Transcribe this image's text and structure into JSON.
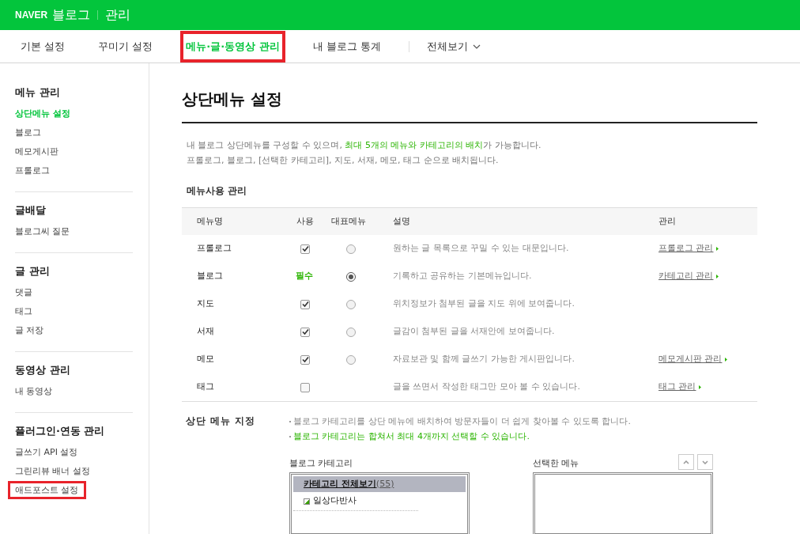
{
  "header": {
    "brand": "NAVER",
    "service": "블로그",
    "section": "관리"
  },
  "nav": {
    "tabs": [
      {
        "label": "기본 설정",
        "selected": false,
        "highlighted": false
      },
      {
        "label": "꾸미기 설정",
        "selected": false,
        "highlighted": false
      },
      {
        "label": "메뉴·글·동영상 관리",
        "selected": true,
        "highlighted": true
      },
      {
        "label": "내 블로그 통계",
        "selected": false,
        "highlighted": false
      }
    ],
    "all_view": "전체보기"
  },
  "sidebar": {
    "groups": [
      {
        "title": "메뉴 관리",
        "items": [
          {
            "label": "상단메뉴 설정",
            "selected": true,
            "highlighted": false
          },
          {
            "label": "블로그",
            "selected": false,
            "highlighted": false
          },
          {
            "label": "메모게시판",
            "selected": false,
            "highlighted": false
          },
          {
            "label": "프롤로그",
            "selected": false,
            "highlighted": false
          }
        ]
      },
      {
        "title": "글배달",
        "items": [
          {
            "label": "블로그씨 질문",
            "selected": false,
            "highlighted": false
          }
        ]
      },
      {
        "title": "글 관리",
        "items": [
          {
            "label": "댓글",
            "selected": false,
            "highlighted": false
          },
          {
            "label": "태그",
            "selected": false,
            "highlighted": false
          },
          {
            "label": "글 저장",
            "selected": false,
            "highlighted": false
          }
        ]
      },
      {
        "title": "동영상 관리",
        "items": [
          {
            "label": "내 동영상",
            "selected": false,
            "highlighted": false
          }
        ]
      },
      {
        "title": "플러그인·연동 관리",
        "items": [
          {
            "label": "글쓰기 API 설정",
            "selected": false,
            "highlighted": false
          },
          {
            "label": "그린리뷰 배너 설정",
            "selected": false,
            "highlighted": false
          },
          {
            "label": "애드포스트 설정",
            "selected": false,
            "highlighted": true
          }
        ]
      }
    ]
  },
  "page": {
    "title": "상단메뉴 설정",
    "description": [
      "내 블로그 상단메뉴를 구성할 수 있으며, **최대 5개의 메뉴와 카테고리의 배치**가 가능합니다.",
      "프롤로그, 블로그, [선택한 카테고리], 지도, 서재, 메모, 태그 순으로 배치됩니다."
    ],
    "menu_usage": {
      "title": "메뉴사용 관리",
      "columns": [
        "메뉴명",
        "사용",
        "대표메뉴",
        "설명",
        "관리"
      ],
      "rows": [
        {
          "name": "프롤로그",
          "kind": "checkbox",
          "checked": true,
          "representative": false,
          "show_radio": true,
          "description": "원하는 글 목록으로 꾸밀 수 있는 대문입니다.",
          "link": "프롤로그 관리"
        },
        {
          "name": "블로그",
          "kind": "required",
          "required_label": "필수",
          "representative": true,
          "show_radio": true,
          "description": "기록하고 공유하는 기본메뉴입니다.",
          "link": "카테고리 관리"
        },
        {
          "name": "지도",
          "kind": "checkbox",
          "checked": true,
          "representative": false,
          "show_radio": true,
          "description": "위치정보가 첨부된 글을 지도 위에 보여줍니다."
        },
        {
          "name": "서재",
          "kind": "checkbox",
          "checked": true,
          "representative": false,
          "show_radio": true,
          "description": "글감이 첨부된 글을 서재안에 보여줍니다."
        },
        {
          "name": "메모",
          "kind": "checkbox",
          "checked": true,
          "representative": false,
          "show_radio": true,
          "description": "자료보관 및 함께 글쓰기 가능한 게시판입니다.",
          "link": "메모게시판 관리"
        },
        {
          "name": "태그",
          "kind": "checkbox",
          "checked": false,
          "description": "글을 쓰면서 작성한 태그만 모아 볼 수 있습니다.",
          "link": "태그 관리"
        }
      ]
    },
    "top_menu": {
      "title": "상단 메뉴 지정",
      "notes": [
        {
          "text": "블로그 카테고리를 상단 메뉴에 배치하여 방문자들이 더 쉽게 찾아볼 수 있도록 합니다.",
          "emphasis": false
        },
        {
          "text": "블로그 카테고리는 합쳐서 최대 4개까지 선택할 수 있습니다.",
          "emphasis": true
        }
      ],
      "category_list": {
        "title": "블로그 카테고리",
        "all": {
          "label": "카테고리 전체보기",
          "count": "(55)"
        },
        "items": [
          "일상다반사"
        ]
      },
      "selected_list": {
        "title": "선택한 메뉴"
      }
    }
  }
}
